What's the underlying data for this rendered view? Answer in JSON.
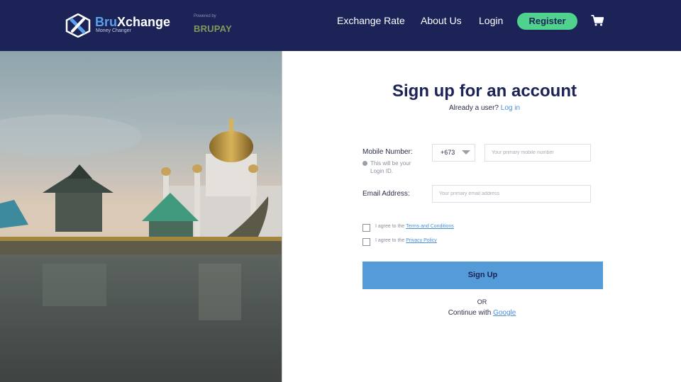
{
  "header": {
    "brand_part1": "Bru",
    "brand_part2": "Xchange",
    "brand_sub": "Money Changer",
    "powered_by": "Powered by",
    "partner": "BRUPAY",
    "nav": {
      "exchange_rate": "Exchange Rate",
      "about_us": "About Us",
      "login": "Login",
      "register": "Register"
    },
    "colors": {
      "bg": "#1b2357",
      "accent": "#5aa0ea",
      "register": "#4fd28e"
    }
  },
  "form": {
    "title": "Sign up for an account",
    "already_user": "Already a user?",
    "login_link": "Log in",
    "mobile_label": "Mobile Number:",
    "mobile_hint": "This will be your Login ID.",
    "country_code": "+673",
    "mobile_placeholder": "Your primary mobile number",
    "email_label": "Email Address:",
    "email_placeholder": "Your primary email address",
    "agree_prefix": "I agree to the",
    "terms_link": "Terms and Conditions",
    "privacy_link": "Privacy Policy",
    "signup_button": "Sign Up",
    "or_text": "OR",
    "continue_with": "Continue with",
    "google_link": "Google",
    "colors": {
      "button": "#559bd8",
      "link": "#4a90d9",
      "title": "#1b2357"
    }
  },
  "icons": [
    "brand-logo-icon",
    "cart-icon",
    "info-icon",
    "chevron-down-icon"
  ]
}
